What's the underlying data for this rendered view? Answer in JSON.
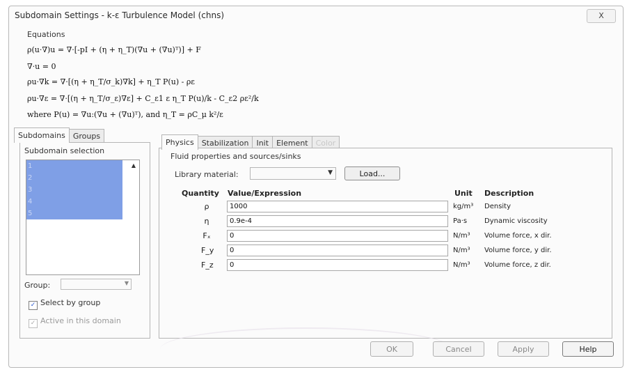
{
  "window": {
    "title": "Subdomain Settings - k-ε Turbulence Model (chns)",
    "close_symbol": "X"
  },
  "equations": {
    "label": "Equations",
    "lines": [
      "ρ(u·∇)u = ∇·[-pI + (η + η_T)(∇u + (∇u)ᵀ)] + F",
      "∇·u = 0",
      "ρu·∇k = ∇·[(η + η_T/σ_k)∇k] + η_T P(u) - ρε",
      "ρu·∇ε = ∇·[(η + η_T/σ_ε)∇ε] + C_ε1 ε η_T P(u)/k - C_ε2 ρε²/k",
      "where P(u) = ∇u:(∇u + (∇u)ᵀ), and η_T = ρC_μ k²/ε"
    ]
  },
  "left_panel": {
    "tabs": [
      {
        "label": "Subdomains",
        "active": true
      },
      {
        "label": "Groups",
        "active": false
      }
    ],
    "selection_label": "Subdomain selection",
    "items": [
      "1",
      "2",
      "3",
      "4",
      "5"
    ],
    "group_label": "Group:",
    "group_value": "",
    "select_by_group": {
      "label": "Select by group",
      "checked": true
    },
    "active_in_domain": {
      "label": "Active in this domain",
      "checked": true,
      "disabled": true
    }
  },
  "right_panel": {
    "tabs": [
      {
        "label": "Physics",
        "active": true
      },
      {
        "label": "Stabilization",
        "active": false
      },
      {
        "label": "Init",
        "active": false
      },
      {
        "label": "Element",
        "active": false
      },
      {
        "label": "Color",
        "active": false,
        "disabled": true
      }
    ],
    "section_label": "Fluid properties and sources/sinks",
    "library_label": "Library material:",
    "library_value": "",
    "load_button": "Load...",
    "columns": {
      "quantity": "Quantity",
      "value": "Value/Expression",
      "unit": "Unit",
      "description": "Description"
    },
    "rows": [
      {
        "symbol": "ρ",
        "value": "1000",
        "unit": "kg/m³",
        "description": "Density"
      },
      {
        "symbol": "η",
        "value": "0.9e-4",
        "unit": "Pa·s",
        "description": "Dynamic viscosity"
      },
      {
        "symbol": "Fₓ",
        "value": "0",
        "unit": "N/m³",
        "description": "Volume force, x dir."
      },
      {
        "symbol": "F_y",
        "value": "0",
        "unit": "N/m³",
        "description": "Volume force, y dir."
      },
      {
        "symbol": "F_z",
        "value": "0",
        "unit": "N/m³",
        "description": "Volume force, z dir."
      }
    ]
  },
  "buttons": {
    "ok": "OK",
    "cancel": "Cancel",
    "apply": "Apply",
    "help": "Help"
  },
  "colors": {
    "selection": "#7f9fe6",
    "checkbox_tick": "#2a5bd0"
  }
}
